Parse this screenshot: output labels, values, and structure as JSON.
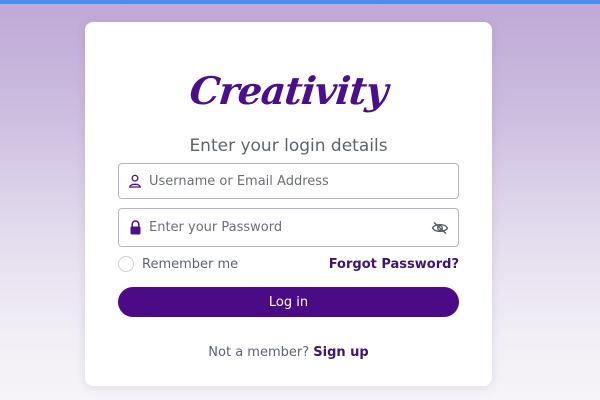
{
  "colors": {
    "brand": "#4b0f8c",
    "button": "#4b0a86",
    "link": "#3e1575",
    "top_bar": "#4a8df0"
  },
  "login": {
    "logo_text": "Creativity",
    "subtitle": "Enter your login details",
    "username": {
      "placeholder": "Username or Email Address",
      "value": "",
      "icon": "user-icon"
    },
    "password": {
      "placeholder": "Enter your Password",
      "value": "",
      "icon": "lock-icon",
      "toggle_icon": "eye-slash-icon"
    },
    "remember_label": "Remember me",
    "remember_checked": false,
    "forgot_label": "Forgot Password?",
    "login_label": "Log in",
    "signup_prompt": "Not a member?",
    "signup_label": "Sign up"
  }
}
